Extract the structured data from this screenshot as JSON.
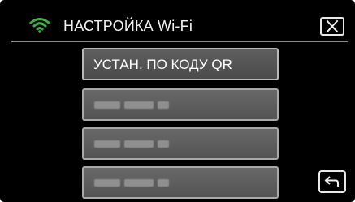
{
  "header": {
    "title": "НАСТРОЙКА Wi-Fi",
    "wifi_icon": "wifi-icon",
    "close_icon": "close-icon",
    "accent_color": "#3fae49"
  },
  "menu": {
    "items": [
      {
        "label": "УСТАН. ПО КОДУ QR",
        "state": "selected"
      },
      {
        "label": "",
        "state": "obscured"
      },
      {
        "label": "",
        "state": "obscured"
      },
      {
        "label": "",
        "state": "obscured"
      }
    ]
  },
  "footer": {
    "back_icon": "return-arrow-icon"
  }
}
